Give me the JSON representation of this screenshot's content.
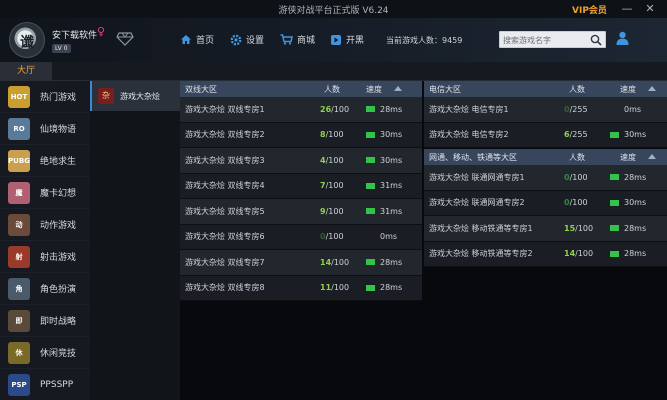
{
  "window": {
    "title": "游侠对战平台正式版 V6.24",
    "vip": "VIP会员",
    "min_glyph": "—",
    "close_glyph": "✕"
  },
  "user": {
    "name": "安下载软件",
    "gender_glyph": "♀",
    "level": "LV 0",
    "avatar_glyph": "谶"
  },
  "nav": {
    "home": "首页",
    "settings": "设置",
    "mall": "商城",
    "broadcast": "开黑"
  },
  "online_count": "当前游戏人数：9459",
  "search": {
    "placeholder": "搜索游戏名字"
  },
  "tabs": {
    "hall": "大厅"
  },
  "sidebar": {
    "items": [
      {
        "label": "热门游戏",
        "icon": "hot-icon",
        "badge": "HOT",
        "color": "#c9a030"
      },
      {
        "label": "仙境物语",
        "icon": "ro-icon",
        "badge": "RO",
        "color": "#5a7a9a"
      },
      {
        "label": "绝地求生",
        "icon": "pubg-icon",
        "badge": "PUBG",
        "color": "#c9a050"
      },
      {
        "label": "魔卡幻想",
        "icon": "card-icon",
        "badge": "魔",
        "color": "#b06070"
      },
      {
        "label": "动作游戏",
        "icon": "action-icon",
        "badge": "动",
        "color": "#6a4a3a"
      },
      {
        "label": "射击游戏",
        "icon": "shooter-icon",
        "badge": "射",
        "color": "#9a3a2a"
      },
      {
        "label": "角色扮演",
        "icon": "rpg-icon",
        "badge": "角",
        "color": "#4a5a6a"
      },
      {
        "label": "即时战略",
        "icon": "rts-icon",
        "badge": "即",
        "color": "#5a4a3a"
      },
      {
        "label": "休闲竞技",
        "icon": "casual-icon",
        "badge": "休",
        "color": "#7a6a2a"
      },
      {
        "label": "PPSSPP",
        "icon": "psp-icon",
        "badge": "PSP",
        "color": "#2a4a8a"
      }
    ]
  },
  "subnav": {
    "item": "游戏大杂烩",
    "icon_glyph": "杂"
  },
  "left_table": {
    "header": {
      "zone": "双线大区",
      "players": "人数",
      "speed": "速度"
    },
    "rows": [
      {
        "name": "游戏大杂烩  双线专房1",
        "cur": "26",
        "max": "/100",
        "speed": "28ms",
        "signal": true
      },
      {
        "name": "游戏大杂烩  双线专房2",
        "cur": "8",
        "max": "/100",
        "speed": "30ms",
        "signal": true
      },
      {
        "name": "游戏大杂烩  双线专房3",
        "cur": "4",
        "max": "/100",
        "speed": "30ms",
        "signal": true
      },
      {
        "name": "游戏大杂烩  双线专房4",
        "cur": "7",
        "max": "/100",
        "speed": "31ms",
        "signal": true
      },
      {
        "name": "游戏大杂烩  双线专房5",
        "cur": "9",
        "max": "/100",
        "speed": "31ms",
        "signal": true
      },
      {
        "name": "游戏大杂烩  双线专房6",
        "cur": "0",
        "max": "/100",
        "speed": "0ms",
        "signal": false
      },
      {
        "name": "游戏大杂烩  双线专房7",
        "cur": "14",
        "max": "/100",
        "speed": "28ms",
        "signal": true
      },
      {
        "name": "游戏大杂烩  双线专房8",
        "cur": "11",
        "max": "/100",
        "speed": "28ms",
        "signal": true
      }
    ]
  },
  "telecom_table": {
    "header": {
      "zone": "电信大区",
      "players": "人数",
      "speed": "速度"
    },
    "rows": [
      {
        "name": "游戏大杂烩  电信专房1",
        "cur": "0",
        "max": "/255",
        "speed": "0ms",
        "signal": false
      },
      {
        "name": "游戏大杂烩  电信专房2",
        "cur": "6",
        "max": "/255",
        "speed": "30ms",
        "signal": true
      }
    ]
  },
  "unicom_table": {
    "header": {
      "zone": "网通、移动、铁通等大区",
      "players": "人数",
      "speed": "速度"
    },
    "rows": [
      {
        "name": "游戏大杂烩  联通网通专房1",
        "cur": "0",
        "max": "/100",
        "speed": "28ms",
        "signal": true
      },
      {
        "name": "游戏大杂烩  联通网通专房2",
        "cur": "0",
        "max": "/100",
        "speed": "30ms",
        "signal": true
      },
      {
        "name": "游戏大杂烩  移动铁通等专房1",
        "cur": "15",
        "max": "/100",
        "speed": "28ms",
        "signal": true
      },
      {
        "name": "游戏大杂烩  移动铁通等专房2",
        "cur": "14",
        "max": "/100",
        "speed": "28ms",
        "signal": true
      }
    ]
  },
  "colors": {
    "count_active": "#8fd14a",
    "count_zero": "#2f8a3a",
    "count_dim": "#3a5a3a",
    "signal": "#34c34a",
    "accent": "#f4a23a",
    "vip": "#f0a030"
  }
}
